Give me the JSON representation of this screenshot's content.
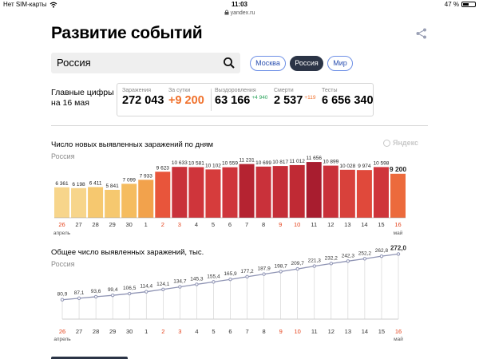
{
  "status": {
    "carrier": "Нет SIM-карты",
    "time": "11:03",
    "battery": "47 %",
    "battery_level": 0.47,
    "url": "yandex.ru"
  },
  "page": {
    "title": "Развитие событий"
  },
  "search": {
    "query": "Россия"
  },
  "regions": [
    {
      "label": "Москва",
      "active": false
    },
    {
      "label": "Россия",
      "active": true
    },
    {
      "label": "Мир",
      "active": false
    }
  ],
  "main_figures": {
    "label_line1": "Главные цифры",
    "label_line2": "на 16 мая"
  },
  "stats": {
    "infections_label": "Заражения",
    "infections_value": "272 043",
    "daily_label": "За сутки",
    "daily_value": "+9 200",
    "recovered_label": "Выздоровления",
    "recovered_value": "63 166",
    "recovered_delta": "+4 940",
    "deaths_label": "Смерти",
    "deaths_value": "2 537",
    "deaths_delta": "+119",
    "tests_label": "Тесты",
    "tests_value": "6 656 340"
  },
  "colors": {
    "accent_orange": "#f0712c",
    "recovered_green": "#29a35a",
    "weekend_red": "#e5421b",
    "active_region": "#2b3446",
    "line": "#8f94b4"
  },
  "chart_data": [
    {
      "type": "bar",
      "title": "Число новых выявленных заражений по дням",
      "subtitle": "Россия",
      "watermark": "Яндекс",
      "categories": [
        "26",
        "27",
        "28",
        "29",
        "30",
        "1",
        "2",
        "3",
        "4",
        "5",
        "6",
        "7",
        "8",
        "9",
        "10",
        "11",
        "12",
        "13",
        "14",
        "15",
        "16"
      ],
      "month_labels": [
        {
          "index": 0,
          "label": "апрель"
        },
        {
          "index": 20,
          "label": "май"
        }
      ],
      "weekend_indices": [
        0,
        6,
        7,
        13,
        14,
        20
      ],
      "values": [
        6361,
        6198,
        6411,
        5841,
        7099,
        7933,
        9623,
        10633,
        10581,
        10102,
        10559,
        11231,
        10699,
        10817,
        11012,
        11656,
        10899,
        10028,
        9974,
        10598,
        9200
      ],
      "value_labels": [
        "6 361",
        "6 198",
        "6 411",
        "5 841",
        "7 099",
        "7 933",
        "9 623",
        "10 633",
        "10 581",
        "10 102",
        "10 559",
        "11 231",
        "10 699",
        "10 817",
        "11 012",
        "11 656",
        "10 899",
        "10 028",
        "9 974",
        "10 598",
        "9 200"
      ],
      "bar_colors": [
        "#f7d58b",
        "#f7d58b",
        "#f6c86f",
        "#f6c86f",
        "#f5bc5f",
        "#f2a24c",
        "#e8553b",
        "#c9313a",
        "#cf353b",
        "#d63c3c",
        "#cf353b",
        "#b52331",
        "#c9313a",
        "#c52d37",
        "#c02a34",
        "#a81d2f",
        "#c9313a",
        "#d8413b",
        "#e0493b",
        "#cf353b",
        "#ec6a3c"
      ],
      "ylim": [
        0,
        12000
      ]
    },
    {
      "type": "line",
      "title": "Общее число выявленных заражений, тыс.",
      "subtitle": "Россия",
      "categories": [
        "26",
        "27",
        "28",
        "29",
        "30",
        "1",
        "2",
        "3",
        "4",
        "5",
        "6",
        "7",
        "8",
        "9",
        "10",
        "11",
        "12",
        "13",
        "14",
        "15",
        "16"
      ],
      "month_labels": [
        {
          "index": 0,
          "label": "апрель"
        },
        {
          "index": 20,
          "label": "май"
        }
      ],
      "weekend_indices": [
        0,
        6,
        7,
        13,
        14,
        20
      ],
      "values": [
        80.9,
        87.1,
        93.6,
        99.4,
        106.5,
        114.4,
        124.1,
        134.7,
        145.3,
        155.4,
        165.9,
        177.2,
        187.9,
        198.7,
        209.7,
        221.3,
        232.2,
        242.3,
        252.2,
        262.8,
        272.0
      ],
      "value_labels": [
        "80,9",
        "87,1",
        "93,6",
        "99,4",
        "106,5",
        "114,4",
        "124,1",
        "134,7",
        "145,3",
        "155,4",
        "165,9",
        "177,2",
        "187,9",
        "198,7",
        "209,7",
        "221,3",
        "232,2",
        "242,3",
        "252,2",
        "262,8",
        "272,0"
      ],
      "ylim": [
        0,
        300
      ]
    }
  ]
}
